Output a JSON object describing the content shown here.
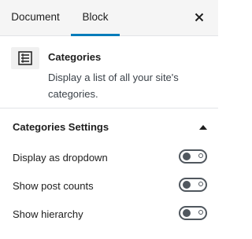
{
  "tabs": [
    {
      "label": "Document",
      "active": false
    },
    {
      "label": "Block",
      "active": true
    }
  ],
  "close_icon": "close-icon",
  "accent_color": "#007cba",
  "block": {
    "icon": "list-icon",
    "title": "Categories",
    "description": "Display a list of all your site's categories."
  },
  "settings": {
    "title": "Categories Settings",
    "expanded": true,
    "caret_icon": "caret-up-icon",
    "toggles": [
      {
        "label": "Display as dropdown",
        "checked": false
      },
      {
        "label": "Show post counts",
        "checked": false
      },
      {
        "label": "Show hierarchy",
        "checked": false
      }
    ]
  }
}
